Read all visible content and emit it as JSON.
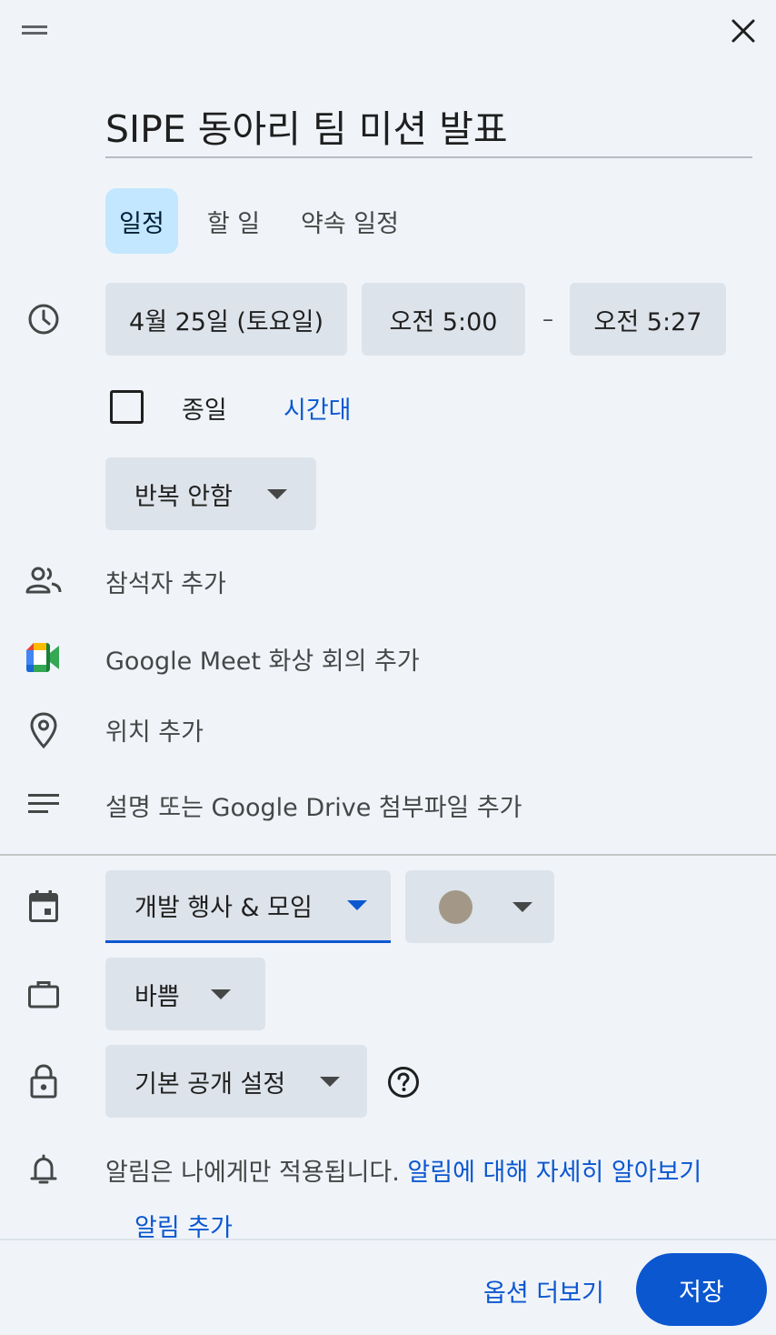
{
  "header": {
    "drag_icon": "drag-handle-icon",
    "close_icon": "close-icon"
  },
  "title": {
    "value": "SIPE 동아리 팀 미션 발표"
  },
  "tabs": [
    {
      "label": "일정",
      "selected": true
    },
    {
      "label": "할 일",
      "selected": false
    },
    {
      "label": "약속 일정",
      "selected": false
    }
  ],
  "datetime": {
    "date": "4월 25일 (토요일)",
    "start": "오전 5:00",
    "separator": "–",
    "end": "오전 5:27",
    "all_day_label": "종일",
    "all_day_checked": false,
    "timezone_link": "시간대"
  },
  "repeat": {
    "label": "반복 안함"
  },
  "guests": {
    "placeholder": "참석자 추가"
  },
  "meet": {
    "label": "Google Meet 화상 회의 추가"
  },
  "location": {
    "placeholder": "위치 추가"
  },
  "description": {
    "placeholder": "설명 또는 Google Drive 첨부파일 추가"
  },
  "calendar": {
    "name": "개발 행사 & 모임",
    "color": "#a39887"
  },
  "availability": {
    "label": "바쁨"
  },
  "visibility": {
    "label": "기본 공개 설정"
  },
  "notifications": {
    "note": "알림은 나에게만 적용됩니다.",
    "learn_more": "알림에 대해 자세히 알아보기",
    "add": "알림 추가"
  },
  "footer": {
    "more_options": "옵션 더보기",
    "save": "저장"
  },
  "colors": {
    "accent": "#0b57d0",
    "tab_selected_bg": "#c2e7ff",
    "chip_bg": "#dde3ea",
    "panel_bg": "#f0f4f9"
  }
}
